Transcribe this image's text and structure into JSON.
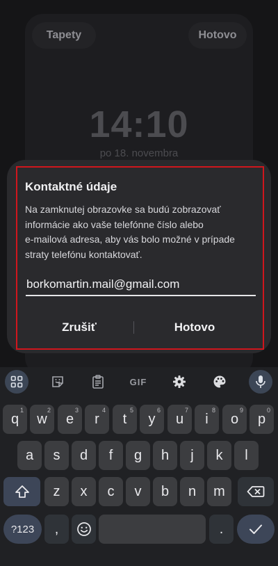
{
  "lockscreen": {
    "wallpapers_button": "Tapety",
    "done_button": "Hotovo",
    "time": "14:10",
    "date": "po 18. novembra"
  },
  "dialog": {
    "title": "Kontaktné údaje",
    "body_lines": [
      "Na zamknutej obrazovke sa budú zobrazovať",
      "informácie ako vaše telefónne číslo alebo",
      "e-mailová adresa, aby vás bolo možné v prípade",
      "straty telefónu kontaktovať."
    ],
    "email_value": "borkomartin.mail@gmail.com",
    "cancel_label": "Zrušiť",
    "ok_label": "Hotovo"
  },
  "keyboard": {
    "toolbar": [
      "apps-grid-icon",
      "sticker-icon",
      "clipboard-icon",
      "GIF",
      "gear-icon",
      "palette-icon",
      "microphone-icon"
    ],
    "row1": [
      {
        "key": "q",
        "hint": "1"
      },
      {
        "key": "w",
        "hint": "2"
      },
      {
        "key": "e",
        "hint": "3"
      },
      {
        "key": "r",
        "hint": "4"
      },
      {
        "key": "t",
        "hint": "5"
      },
      {
        "key": "y",
        "hint": "6"
      },
      {
        "key": "u",
        "hint": "7"
      },
      {
        "key": "i",
        "hint": "8"
      },
      {
        "key": "o",
        "hint": "9"
      },
      {
        "key": "p",
        "hint": "0"
      }
    ],
    "row2": [
      "a",
      "s",
      "d",
      "f",
      "g",
      "h",
      "j",
      "k",
      "l"
    ],
    "row3": [
      "z",
      "x",
      "c",
      "v",
      "b",
      "n",
      "m"
    ],
    "symbols_key": "?123",
    "comma_key": ",",
    "period_key": ".",
    "colors": {
      "accent": "#3d4658",
      "key": "#3c3d40",
      "highlight_border": "#d0161d"
    }
  }
}
